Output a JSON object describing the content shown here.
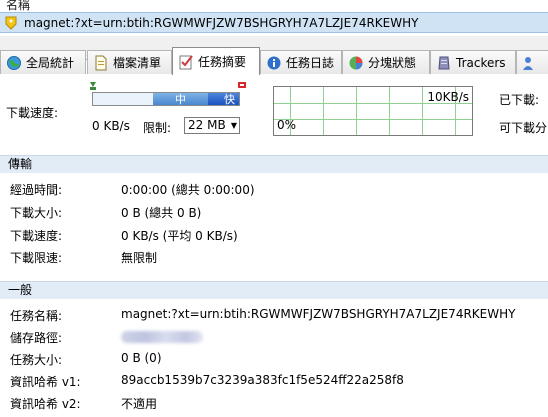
{
  "list": {
    "column_header": "名稱",
    "row_name": "magnet:?xt=urn:btih:RGWMWFJZW7BSHGRYH7A7LZJE74RKEWHY"
  },
  "tabs": [
    {
      "label": "全局統計",
      "icon": "globe-icon"
    },
    {
      "label": "檔案清單",
      "icon": "file-icon"
    },
    {
      "label": "任務摘要",
      "icon": "checklist-icon"
    },
    {
      "label": "任務日誌",
      "icon": "info-icon"
    },
    {
      "label": "分塊狀態",
      "icon": "pie-chart-icon"
    },
    {
      "label": "Trackers",
      "icon": "server-icon"
    }
  ],
  "speed": {
    "label": "下載速度:",
    "bar_mid": "中",
    "bar_fast": "快",
    "current": "0 KB/s",
    "limit_label": "限制:",
    "limit_value": "22 MB",
    "graph_max": "10KB/s",
    "graph_min": "0%"
  },
  "right_panel": {
    "downloaded": "已下載:",
    "can_download": "可下載分"
  },
  "transfer": {
    "header": "傳輸",
    "rows": [
      {
        "label": "經過時間:",
        "value": "0:00:00 (總共 0:00:00)"
      },
      {
        "label": "下載大小:",
        "value": "0 B (總共 0 B)"
      },
      {
        "label": "下載速度:",
        "value": "0 KB/s (平均 0 KB/s)"
      },
      {
        "label": "下載限速:",
        "value": "無限制"
      }
    ]
  },
  "general": {
    "header": "一般",
    "task_name_label": "任務名稱:",
    "task_name": "magnet:?xt=urn:btih:RGWMWFJZW7BSHGRYH7A7LZJE74RKEWHY",
    "save_path_label": "儲存路徑:",
    "task_size_label": "任務大小:",
    "task_size": "0 B (0)",
    "hash_v1_label": "資訊哈希 v1:",
    "hash_v1": "89accb1539b7c3239a383fc1f5e524ff22a258f8",
    "hash_v2_label": "資訊哈希 v2:",
    "hash_v2": "不適用"
  },
  "colors": {
    "selected_row": "#cfe3f4",
    "section_header": "#e1ecf7",
    "graph_grid": "#8fd18f",
    "bar_fast": "#1c52c0"
  }
}
